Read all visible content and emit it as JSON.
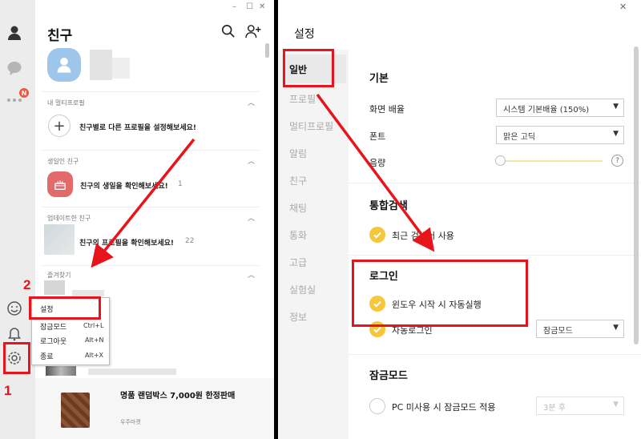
{
  "friends_window": {
    "title": "친구",
    "sections": [
      {
        "label": "내 멀티프로필",
        "row_text": "친구별로 다른 프로필을 설정해보세요!"
      },
      {
        "label": "생일인 친구",
        "row_text": "친구의 생일을 확인해보세요!",
        "count": "1"
      },
      {
        "label": "업데이트한 친구",
        "row_text": "친구의 프로필을 확인해보세요!",
        "count": "22"
      },
      {
        "label": "즐겨찾기"
      }
    ],
    "badge": "N",
    "context_menu": [
      {
        "label": "설정",
        "shortcut": ""
      },
      {
        "label": "잠금모드",
        "shortcut": "Ctrl+L"
      },
      {
        "label": "로그아웃",
        "shortcut": "Alt+N"
      },
      {
        "label": "종료",
        "shortcut": "Alt+X"
      }
    ],
    "ad": {
      "title": "명품 랜덤박스 7,000원 한정판매",
      "source": "우주마켓"
    }
  },
  "settings_window": {
    "title": "설정",
    "close": "✕",
    "nav": [
      "일반",
      "프로필",
      "멀티프로필",
      "알림",
      "친구",
      "채팅",
      "통화",
      "고급",
      "실험실",
      "정보"
    ],
    "active_nav": "일반",
    "basic_heading": "기본",
    "screen_scale_label": "화면 배율",
    "screen_scale_value": "시스템 기본배율 (150%)",
    "font_label": "폰트",
    "font_value": "맑은 고딕",
    "volume_label": "음량",
    "volume_level": 0,
    "help": "?",
    "search_heading": "통합검색",
    "recent_search_label": "최근 검색어 사용",
    "login_heading": "로그인",
    "autostart_label": "윈도우 시작 시 자동실행",
    "autologin_label": "자동로그인",
    "autologin_value": "잠금모드",
    "lock_heading": "잠금모드",
    "lock_label": "PC 미사용 시 잠금모드 적용",
    "lock_value": "3분 후"
  },
  "annotations": {
    "step1": "1",
    "step2": "2"
  },
  "colors": {
    "accent_red": "#e8141c",
    "check_yellow": "#f6c73b",
    "badge": "#f5553f"
  }
}
